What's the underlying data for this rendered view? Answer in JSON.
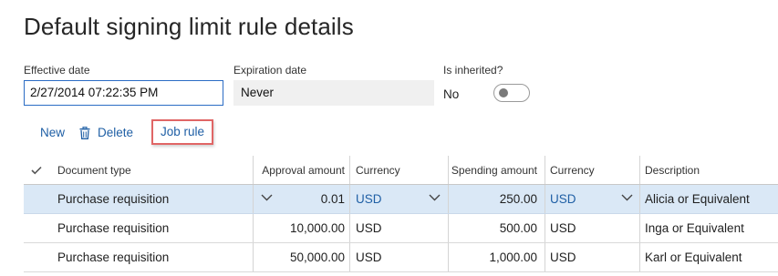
{
  "page": {
    "title": "Default signing limit rule details"
  },
  "fields": {
    "effective_date": {
      "label": "Effective date",
      "value": "2/27/2014 07:22:35 PM"
    },
    "expiration_date": {
      "label": "Expiration date",
      "value": "Never"
    },
    "is_inherited": {
      "label": "Is inherited?",
      "value": "No",
      "toggle_on": false
    }
  },
  "toolbar": {
    "new_label": "New",
    "delete_label": "Delete",
    "job_rule_label": "Job rule"
  },
  "grid": {
    "columns": [
      "Document type",
      "Approval amount",
      "Currency",
      "Spending amount",
      "Currency",
      "Description"
    ],
    "rows": [
      {
        "document_type": "Purchase requisition",
        "approval_amount": "0.01",
        "approval_currency": "USD",
        "spending_amount": "250.00",
        "spending_currency": "USD",
        "description": "Alicia or Equivalent",
        "selected": true
      },
      {
        "document_type": "Purchase requisition",
        "approval_amount": "10,000.00",
        "approval_currency": "USD",
        "spending_amount": "500.00",
        "spending_currency": "USD",
        "description": "Inga or Equivalent",
        "selected": false
      },
      {
        "document_type": "Purchase requisition",
        "approval_amount": "50,000.00",
        "approval_currency": "USD",
        "spending_amount": "1,000.00",
        "spending_currency": "USD",
        "description": "Karl or Equivalent",
        "selected": false
      }
    ]
  },
  "colors": {
    "accent": "#1f5fa5",
    "selection": "#dae8f6",
    "highlight_box": "#e06666"
  }
}
